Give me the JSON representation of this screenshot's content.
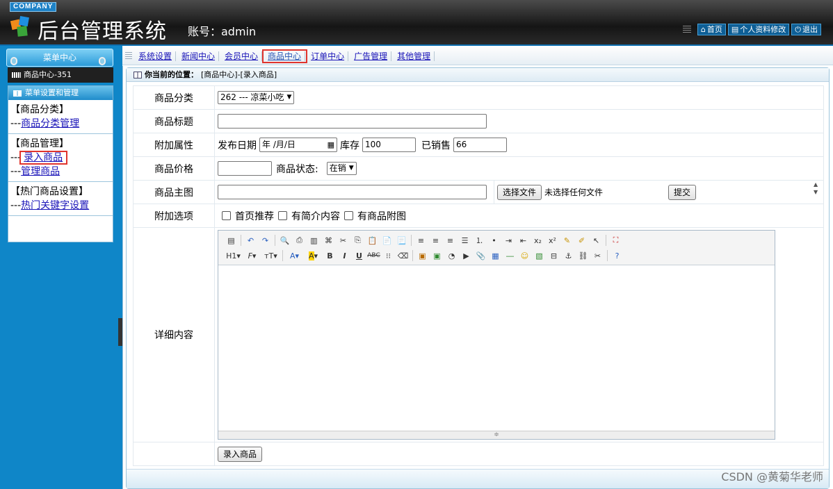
{
  "header": {
    "company": "COMPANY",
    "title": "后台管理系统",
    "account": "账号：admin",
    "links": [
      "首页",
      "个人资料修改",
      "退出"
    ]
  },
  "sidebar": {
    "menu_center": "菜单中心",
    "sub_title": "商品中心-351",
    "panel_title": "菜单设置和管理",
    "groups": [
      {
        "title": "【商品分类】",
        "links": [
          "商品分类管理"
        ]
      },
      {
        "title": "【商品管理】",
        "links": [
          "录入商品",
          "管理商品"
        ]
      },
      {
        "title": "【热门商品设置】",
        "links": [
          "热门关键字设置"
        ]
      }
    ],
    "link_prefix": "---"
  },
  "nav": {
    "items": [
      "系统设置",
      "新闻中心",
      "会员中心",
      "商品中心",
      "订单中心",
      "广告管理",
      "其他管理"
    ],
    "active": "商品中心"
  },
  "breadcrumb": {
    "label": "你当前的位置：",
    "path": "[商品中心]-[录入商品]"
  },
  "form": {
    "category": {
      "label": "商品分类",
      "value": "262 --- 凉菜小吃"
    },
    "title": {
      "label": "商品标题",
      "value": ""
    },
    "extra": {
      "label": "附加属性",
      "date_label": "发布日期",
      "date_value": "年 /月/日",
      "stock_label": "库存",
      "stock_value": "100",
      "sold_label": "已销售",
      "sold_value": "66"
    },
    "price": {
      "label": "商品价格",
      "value": "",
      "status_label": "商品状态:",
      "status_value": "在销"
    },
    "image": {
      "label": "商品主图",
      "choose_file": "选择文件",
      "no_file": "未选择任何文件",
      "submit": "提交"
    },
    "options": {
      "label": "附加选项",
      "items": [
        "首页推荐",
        "有简介内容",
        "有商品附图"
      ]
    },
    "detail": {
      "label": "详细内容"
    },
    "submit_label": "录入商品"
  },
  "watermark": "CSDN @黄菊华老师",
  "colors": {
    "accent": "#0f86c8",
    "highlight": "#e0342d",
    "link": "#1a14b8"
  }
}
